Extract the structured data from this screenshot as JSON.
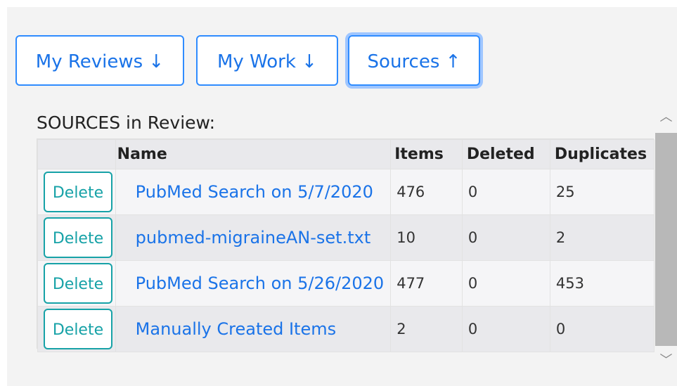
{
  "tabs": {
    "reviews_label": "My Reviews ↓",
    "work_label": "My Work ↓",
    "sources_label": "Sources ↑"
  },
  "section_title": "SOURCES in Review:",
  "table": {
    "headers": [
      "",
      "Name",
      "Items",
      "Deleted",
      "Duplicates"
    ],
    "rows": [
      {
        "action": "Delete",
        "name": "PubMed Search on 5/7/2020",
        "items": "476",
        "deleted": "0",
        "duplicates": "25"
      },
      {
        "action": "Delete",
        "name": "pubmed-migraineAN-set.txt",
        "items": "10",
        "deleted": "0",
        "duplicates": "2"
      },
      {
        "action": "Delete",
        "name": "PubMed Search on 5/26/2020",
        "items": "477",
        "deleted": "0",
        "duplicates": "453"
      },
      {
        "action": "Delete",
        "name": "Manually Created Items",
        "items": "2",
        "deleted": "0",
        "duplicates": "0"
      }
    ]
  },
  "scrollbar": {
    "up_icon": "chevron-up-icon",
    "down_icon": "chevron-down-icon"
  },
  "colors": {
    "accent": "#1a73e8",
    "delete": "#17a2a7"
  }
}
